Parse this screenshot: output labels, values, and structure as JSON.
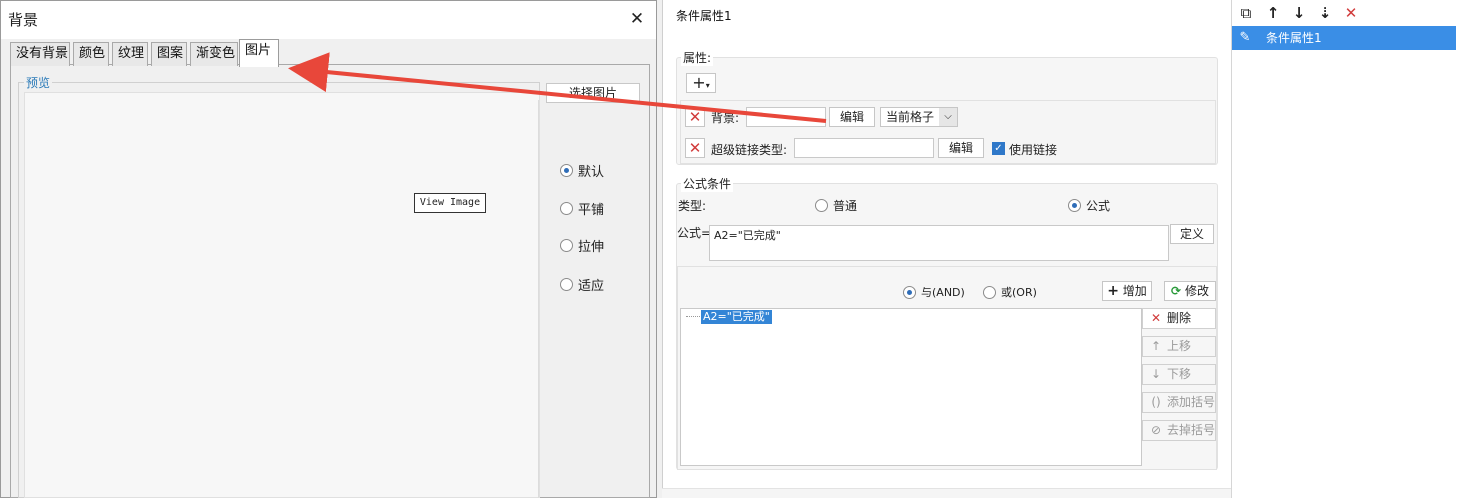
{
  "background_dialog": {
    "title": "背景",
    "close_glyph": "✕",
    "tabs": [
      {
        "label": "没有背景"
      },
      {
        "label": "颜色"
      },
      {
        "label": "纹理"
      },
      {
        "label": "图案"
      },
      {
        "label": "渐变色"
      },
      {
        "label": "图片",
        "active": true
      }
    ],
    "preview_label": "预览",
    "choose_image_button": "选择图片",
    "tooltip": "View Image",
    "layout_options": [
      {
        "label": "默认",
        "selected": true
      },
      {
        "label": "平铺",
        "selected": false
      },
      {
        "label": "拉伸",
        "selected": false
      },
      {
        "label": "适应",
        "selected": false
      }
    ]
  },
  "condition_panel": {
    "title": "条件属性1",
    "attributes_label": "属性:",
    "add_glyph": "+",
    "background_label": "背景:",
    "edit_button": "编辑",
    "scope_select": "当前格子",
    "hyperlink_label": "超级链接类型:",
    "hyperlink_value": "",
    "edit_button_2": "编辑",
    "use_link_label": "使用链接",
    "use_link_checked": true,
    "formula_section_label": "公式条件",
    "type_label": "类型:",
    "type_options": [
      {
        "label": "普通",
        "selected": false
      },
      {
        "label": "公式",
        "selected": true
      }
    ],
    "formula_label": "公式=",
    "formula_value": "A2=\"已完成\"",
    "define_button": "定义",
    "logic_options": [
      {
        "label": "与(AND)",
        "selected": true
      },
      {
        "label": "或(OR)",
        "selected": false
      }
    ],
    "add_button": "增加",
    "modify_button": "修改",
    "conditions": [
      "A2=\"已完成\""
    ],
    "side_buttons": [
      {
        "label": "删除",
        "icon": "✕",
        "enabled": true
      },
      {
        "label": "上移",
        "icon": "↑",
        "enabled": false
      },
      {
        "label": "下移",
        "icon": "↓",
        "enabled": false
      },
      {
        "label": "添加括号",
        "icon": "()",
        "enabled": false
      },
      {
        "label": "去掉括号",
        "icon": "⊘",
        "enabled": false
      }
    ]
  },
  "right_list": {
    "tools": [
      "copy-icon",
      "move-up-icon",
      "move-down-icon",
      "sort-icon",
      "delete-icon"
    ],
    "items": [
      {
        "label": "条件属性1",
        "selected": true
      }
    ]
  },
  "colors": {
    "accent": "#3a8ee6",
    "arrow": "#e8473a",
    "delete": "#d13b3b"
  }
}
